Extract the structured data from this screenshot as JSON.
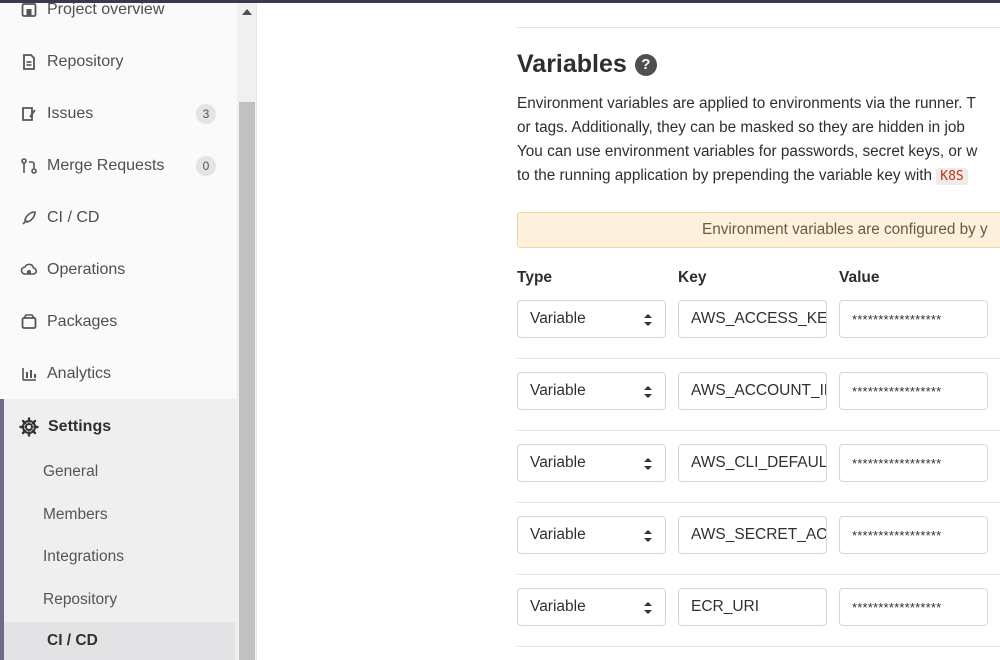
{
  "sidebar": {
    "items": [
      {
        "label": "Project overview",
        "icon": "home-icon"
      },
      {
        "label": "Repository",
        "icon": "doc-icon"
      },
      {
        "label": "Issues",
        "icon": "issues-icon",
        "count": "3"
      },
      {
        "label": "Merge Requests",
        "icon": "merge-request-icon",
        "count": "0"
      },
      {
        "label": "CI / CD",
        "icon": "rocket-icon"
      },
      {
        "label": "Operations",
        "icon": "cloud-gear-icon"
      },
      {
        "label": "Packages",
        "icon": "package-icon"
      },
      {
        "label": "Analytics",
        "icon": "chart-icon"
      }
    ],
    "settings": {
      "label": "Settings",
      "icon": "gear-icon",
      "sub_items": [
        "General",
        "Members",
        "Integrations",
        "Repository"
      ],
      "active": "CI / CD"
    }
  },
  "main": {
    "title": "Variables",
    "description": {
      "line1": "Environment variables are applied to environments via the runner. T",
      "line2": "or tags. Additionally, they can be masked so they are hidden in job",
      "line3": "You can use environment variables for passwords, secret keys, or w",
      "line4_prefix": "to the running application by prepending the variable key with",
      "line4_code": "K8S"
    },
    "alert": "Environment variables are configured by y",
    "columns": {
      "type": "Type",
      "key": "Key",
      "value": "Value"
    },
    "rows": [
      {
        "type": "Variable",
        "key": "AWS_ACCESS_KEY",
        "value": "*****************"
      },
      {
        "type": "Variable",
        "key": "AWS_ACCOUNT_ID",
        "value": "*****************"
      },
      {
        "type": "Variable",
        "key": "AWS_CLI_DEFAULT",
        "value": "*****************"
      },
      {
        "type": "Variable",
        "key": "AWS_SECRET_ACCESS",
        "value": "*****************"
      },
      {
        "type": "Variable",
        "key": "ECR_URI",
        "value": "*****************"
      }
    ]
  }
}
